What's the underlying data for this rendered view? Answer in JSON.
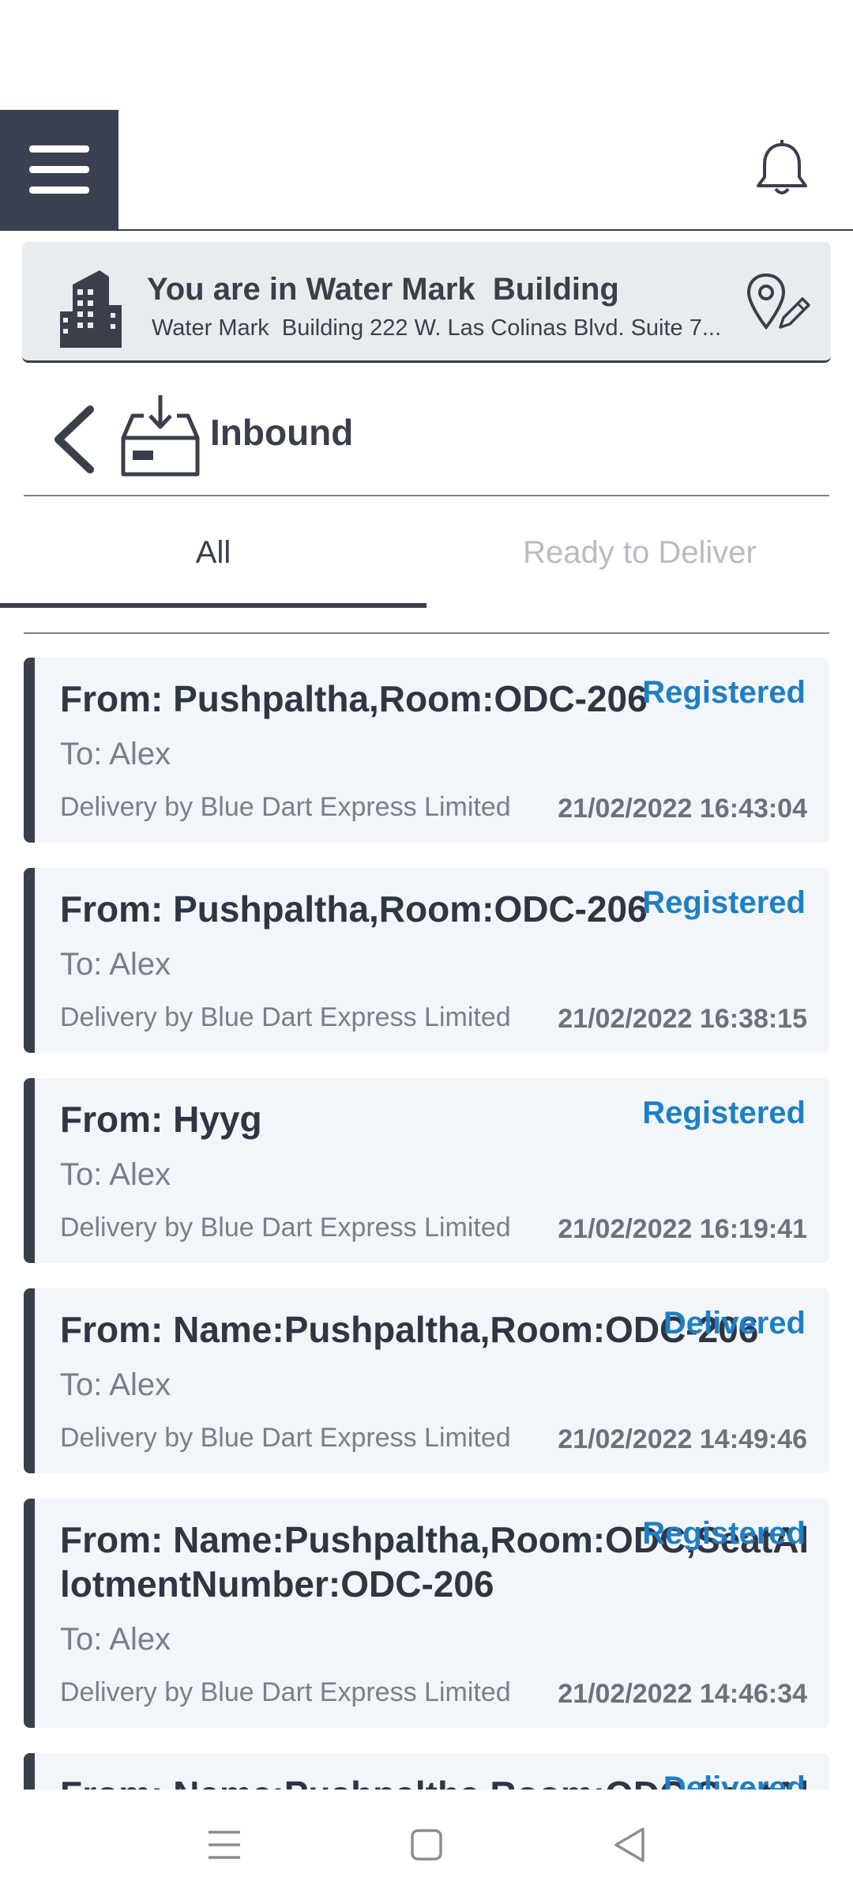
{
  "location": {
    "title": "You are in Water Mark  Building",
    "address": "Water Mark  Building 222 W. Las Colinas Blvd. Suite 7..."
  },
  "section": {
    "title": "Inbound"
  },
  "tabs": [
    {
      "label": "All",
      "active": true
    },
    {
      "label": "Ready to Deliver",
      "active": false
    }
  ],
  "shipments": [
    {
      "from": "From: Pushpaltha,Room:ODC-206",
      "status": "Registered",
      "to": "To: Alex",
      "delivery": "Delivery by Blue Dart Express Limited",
      "time": "21/02/2022 16:43:04"
    },
    {
      "from": "From: Pushpaltha,Room:ODC-206",
      "status": "Registered",
      "to": "To: Alex",
      "delivery": "Delivery by Blue Dart Express Limited",
      "time": "21/02/2022 16:38:15"
    },
    {
      "from": "From: Hyyg",
      "status": "Registered",
      "to": "To: Alex",
      "delivery": "Delivery by Blue Dart Express Limited",
      "time": "21/02/2022 16:19:41"
    },
    {
      "from": "From: Name:Pushpaltha,Room:ODC-206",
      "status": "Delivered",
      "to": "To: Alex",
      "delivery": "Delivery by Blue Dart Express Limited",
      "time": "21/02/2022 14:49:46"
    },
    {
      "from": "From: Name:Pushpaltha,Room:ODC,SeatAllotmentNumber:ODC-206",
      "status": "Registered",
      "to": "To: Alex",
      "delivery": "Delivery by Blue Dart Express Limited",
      "time": "21/02/2022 14:46:34"
    },
    {
      "from": "From: Name:Pushpaltha,Room:ODC,SeatAll",
      "status": "Delivered",
      "to": "",
      "delivery": "",
      "time": ""
    }
  ],
  "colors": {
    "accent": "#1e7fc4",
    "dark": "#3a3f4b",
    "card_bg": "#f2f6fa"
  },
  "icons": [
    "menu-icon",
    "bell-icon",
    "building-icon",
    "location-edit-icon",
    "back-icon",
    "inbox-icon"
  ]
}
